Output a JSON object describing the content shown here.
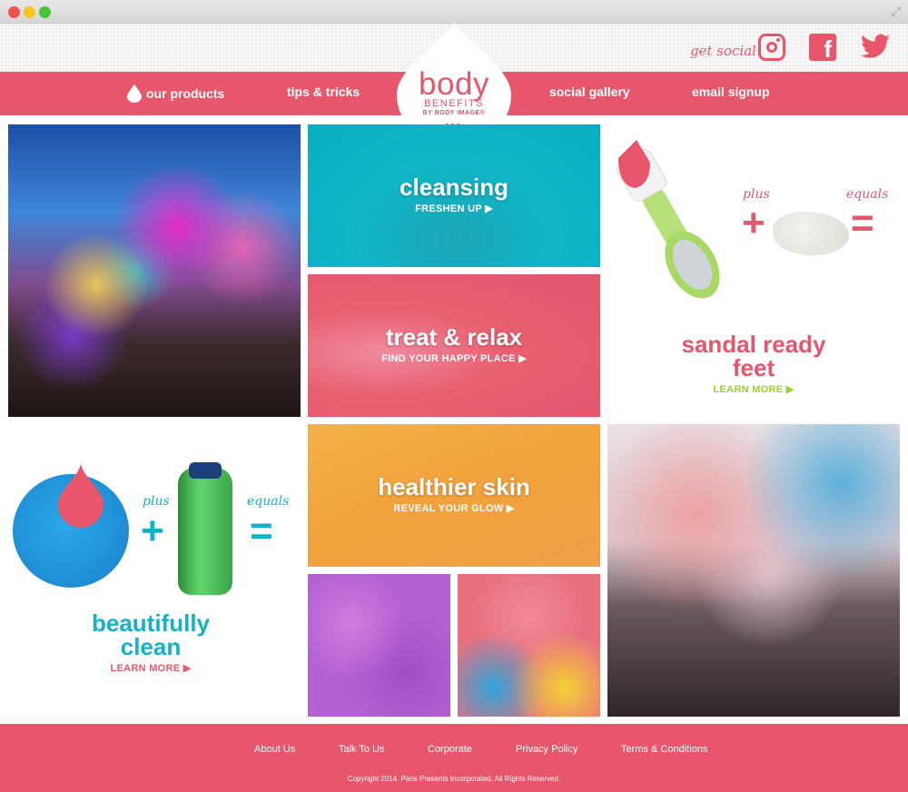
{
  "header": {
    "get_social": "get social",
    "social_icons": [
      "instagram-icon",
      "facebook-icon",
      "twitter-icon"
    ]
  },
  "nav": {
    "items": [
      "our products",
      "tips & tricks",
      "social gallery",
      "email signup"
    ]
  },
  "logo": {
    "wordmark": "body",
    "sub": "BENEFITS",
    "by": "BY BODY IMAGE®",
    "dots": "•••"
  },
  "tiles": {
    "cleansing": {
      "title": "cleansing",
      "link": "FRESHEN UP ▶"
    },
    "treat": {
      "title": "treat & relax",
      "link": "FIND YOUR HAPPY PLACE ▶"
    },
    "healthier": {
      "title": "healthier skin",
      "link": "REVEAL YOUR GLOW ▶"
    }
  },
  "promo_feet": {
    "plus": "plus",
    "equals": "equals",
    "title_line1": "sandal ready",
    "title_line2": "feet",
    "learn_more": "LEARN MORE ▶"
  },
  "promo_clean": {
    "plus": "plus",
    "equals": "equals",
    "title_line1": "beautifully",
    "title_line2": "clean",
    "learn_more": "LEARN MORE ▶"
  },
  "footer": {
    "links": [
      "About Us",
      "Talk To Us",
      "Corporate",
      "Privacy Policy",
      "Terms & Conditions"
    ],
    "copyright": "Copyright 2014. Paris Presents Incorporated. All Rights Reserved."
  },
  "colors": {
    "brand_pink": "#e8566c",
    "teal": "#11b3c5",
    "lime": "#9bd12f"
  }
}
